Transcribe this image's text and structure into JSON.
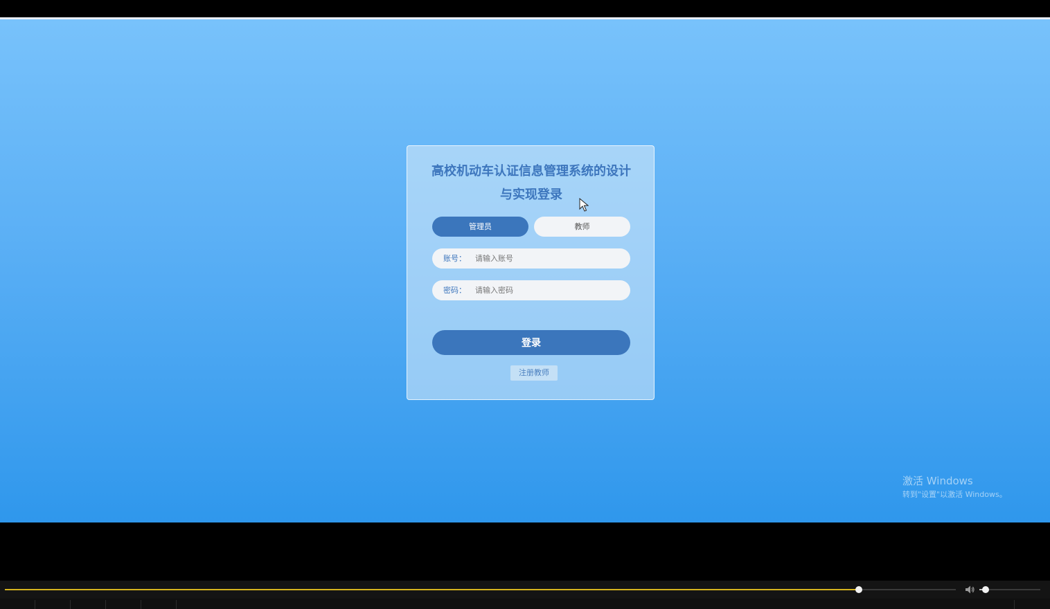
{
  "login": {
    "title": "高校机动车认证信息管理系统的设计与实现登录",
    "roles": {
      "admin": "管理员",
      "teacher": "教师"
    },
    "account": {
      "label": "账号：",
      "placeholder": "请输入账号",
      "value": ""
    },
    "password": {
      "label": "密码：",
      "placeholder": "请输入密码",
      "value": ""
    },
    "submit_label": "登录",
    "register_label": "注册教师"
  },
  "watermark": {
    "line1": "激活 Windows",
    "line2": "转到\"设置\"以激活 Windows。"
  },
  "player": {
    "progress_fraction": 0.898,
    "volume_fraction": 0.1
  },
  "colors": {
    "accent": "#3b76bc",
    "title": "#3d76bd",
    "background_top": "#78c2fb",
    "background_bottom": "#2f97ec",
    "progress": "#d6b51f"
  },
  "icons": {
    "cursor": "mouse-pointer-icon",
    "volume": "speaker-icon"
  }
}
